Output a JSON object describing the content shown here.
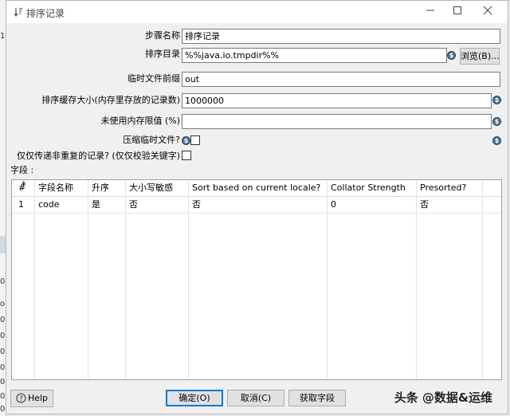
{
  "window": {
    "title": "排序记录"
  },
  "fields": {
    "step_name": {
      "label": "步骤名称",
      "value": "排序记录"
    },
    "sort_dir": {
      "label": "排序目录",
      "value": "%%java.io.tmpdir%%",
      "browse_label": "浏览(B)..."
    },
    "tmp_prefix": {
      "label": "临时文件前缀",
      "value": "out"
    },
    "sort_size": {
      "label": "排序缓存大小(内存里存放的记录数)",
      "value": "1000000"
    },
    "free_mem": {
      "label": "未使用内存限值 (%)",
      "value": ""
    },
    "compress": {
      "label": "压缩临时文件?",
      "checked": false
    },
    "unique": {
      "label": "仅仅传递非重复的记录? (仅仅校验关键字)",
      "checked": false
    }
  },
  "grid": {
    "section_label": "字段 :",
    "columns": [
      "#",
      "字段名称",
      "升序",
      "大小写敏感",
      "Sort based on current locale?",
      "Collator Strength",
      "Presorted?"
    ],
    "rows": [
      [
        "1",
        "code",
        "是",
        "否",
        "否",
        "0",
        "否"
      ]
    ]
  },
  "buttons": {
    "help": "Help",
    "ok": "确定(O)",
    "cancel": "取消(C)",
    "get_fields": "获取字段"
  },
  "watermark": "头条 @数据&运维",
  "background_glyphs": [
    "1",
    "0",
    "o",
    "0",
    "0",
    "0",
    "0",
    "0",
    "0",
    "0"
  ]
}
